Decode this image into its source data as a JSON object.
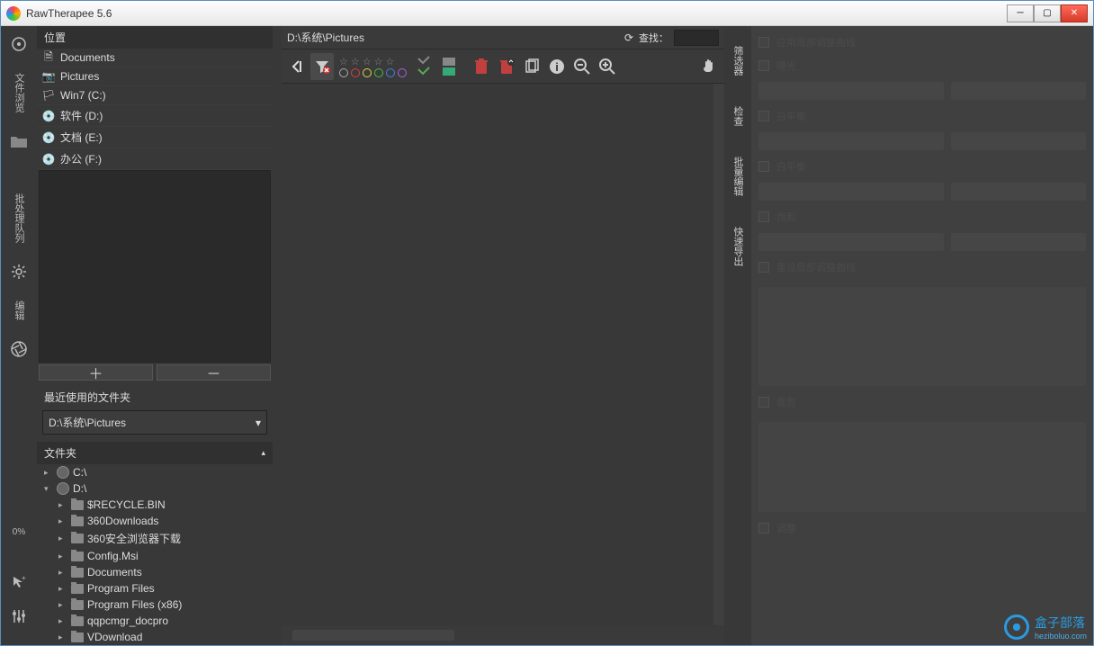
{
  "window": {
    "title": "RawTherapee 5.6"
  },
  "vbar": {
    "tab_file": "文件浏览",
    "tab_queue": "批处理队列",
    "tab_editor": "编辑",
    "percent": "0%"
  },
  "leftpanel": {
    "location_header": "位置",
    "locations": [
      {
        "icon": "document-icon",
        "label": "Documents"
      },
      {
        "icon": "camera-icon",
        "label": "Pictures"
      },
      {
        "icon": "flag-icon",
        "label": "Win7 (C:)"
      },
      {
        "icon": "disk-icon",
        "label": "软件 (D:)"
      },
      {
        "icon": "disk-icon",
        "label": "文档 (E:)"
      },
      {
        "icon": "disk-icon",
        "label": "办公 (F:)"
      }
    ],
    "plus": "＋",
    "minus": "－",
    "recent_label": "最近使用的文件夹",
    "recent_value": "D:\\系统\\Pictures",
    "folders_header": "文件夹",
    "tree_c": "C:\\",
    "tree_d": "D:\\",
    "subfolders": [
      "$RECYCLE.BIN",
      "360Downloads",
      "360安全浏览器下载",
      "Config.Msi",
      "Documents",
      "Program Files",
      "Program Files (x86)",
      "qqpcmgr_docpro",
      "VDownload"
    ]
  },
  "center": {
    "path": "D:\\系统\\Pictures",
    "search_label": "查找："
  },
  "toolbar": {
    "colors": [
      "#aaaaaa",
      "#d84040",
      "#d8d840",
      "#40c040",
      "#4080f0",
      "#b060e0"
    ]
  },
  "rtabs": {
    "t1": "筛选器",
    "t2": "检查",
    "t3": "批量编辑",
    "t4": "快速导出"
  },
  "rightpanel": {
    "l1": "应用局部调整曲线",
    "l2": "曝光",
    "l3": "白平衡",
    "l4": "饱和",
    "l5": "重设局部调整曲线",
    "l6": "裁剪",
    "l7": "调整"
  },
  "watermark": {
    "text": "盒子部落",
    "sub": "heziboluo.com"
  }
}
